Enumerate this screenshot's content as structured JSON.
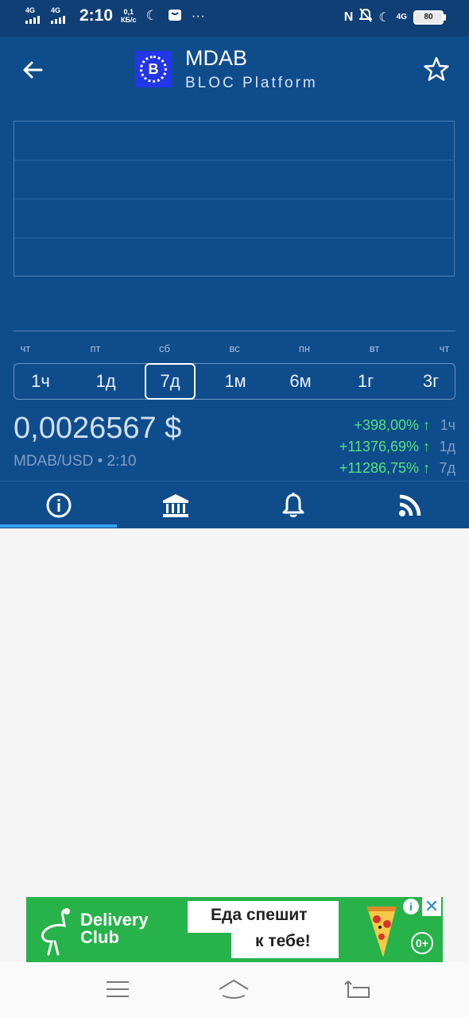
{
  "status_bar": {
    "net1": "4G",
    "net2": "4G",
    "time": "2:10",
    "speed_value": "0,1",
    "speed_unit": "КБ/с",
    "more": "···",
    "net_right": "4G",
    "battery": "80"
  },
  "header": {
    "symbol": "MDAB",
    "name": "BLOC Platform",
    "logo_letter": "B"
  },
  "chart": {
    "days": [
      "чт",
      "пт",
      "сб",
      "вс",
      "пн",
      "вт",
      "чт"
    ]
  },
  "periods": [
    "1ч",
    "1д",
    "7д",
    "1м",
    "6м",
    "1г",
    "3г"
  ],
  "active_period": "7д",
  "price": {
    "value": "0,0026567 $",
    "pair": "MDAB/USD",
    "separator": "•",
    "time": "2:10"
  },
  "changes": [
    {
      "value": "+398,00%",
      "arrow": "↑",
      "period": "1ч"
    },
    {
      "value": "+11376,69%",
      "arrow": "↑",
      "period": "1д"
    },
    {
      "value": "+11286,75%",
      "arrow": "↑",
      "period": "7д"
    }
  ],
  "tabs": [
    {
      "icon": "info-icon"
    },
    {
      "icon": "bank-icon"
    },
    {
      "icon": "bell-icon"
    },
    {
      "icon": "rss-icon"
    }
  ],
  "ad": {
    "brand_line1": "Delivery",
    "brand_line2": "Club",
    "text_line1": "Еда спешит",
    "text_line2": "к тебе!",
    "info": "i",
    "close": "✕",
    "age": "0+"
  },
  "colors": {
    "header_bg": "#0f4c8c",
    "status_bg": "#0f3f75",
    "positive": "#55e27f",
    "tab_indicator": "#3aa0f0",
    "ad_bg": "#27b24a"
  }
}
